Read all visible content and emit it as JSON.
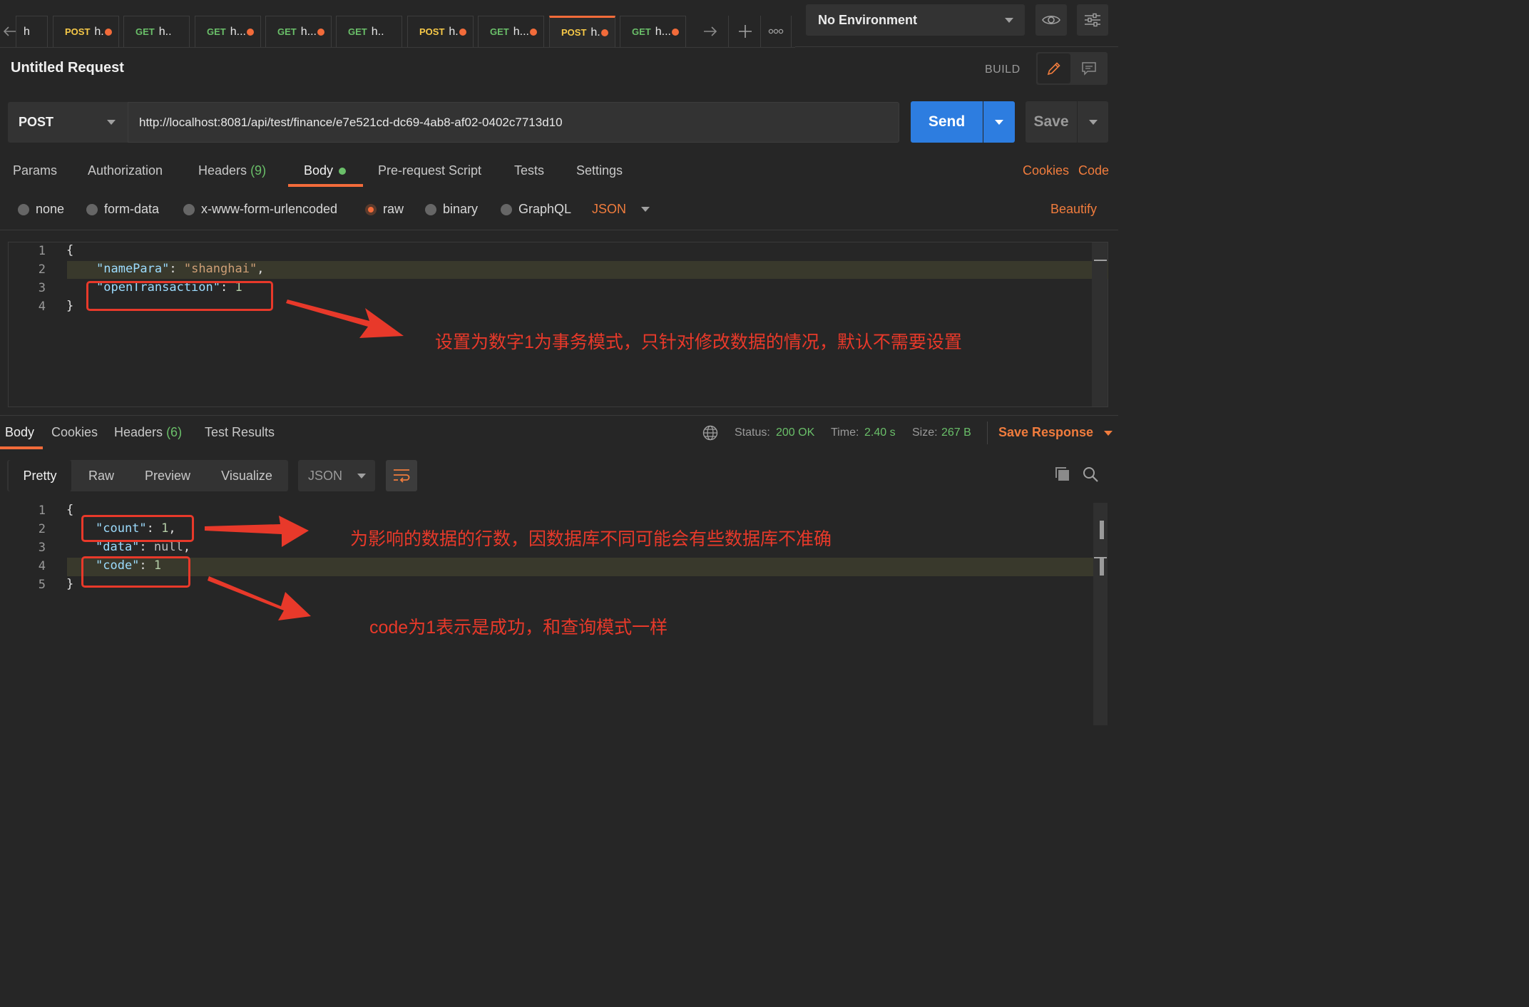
{
  "tabs": {
    "items": [
      {
        "method": "",
        "name": "h"
      },
      {
        "method": "POST",
        "name": "h.",
        "dot": true
      },
      {
        "method": "GET",
        "name": "h..",
        "dot": false
      },
      {
        "method": "GET",
        "name": "h...",
        "dot": true
      },
      {
        "method": "GET",
        "name": "h...",
        "dot": true
      },
      {
        "method": "GET",
        "name": "h..",
        "dot": false
      },
      {
        "method": "POST",
        "name": "h.",
        "dot": true
      },
      {
        "method": "GET",
        "name": "h...",
        "dot": true
      },
      {
        "method": "POST",
        "name": "h.",
        "dot": true,
        "active": true
      },
      {
        "method": "GET",
        "name": "h...",
        "dot": true
      }
    ]
  },
  "environment": {
    "selected": "No Environment"
  },
  "request": {
    "title": "Untitled Request",
    "mode_label": "BUILD",
    "method": "POST",
    "url": "http://localhost:8081/api/test/finance/e7e521cd-dc69-4ab8-af02-0402c7713d10",
    "send_label": "Send",
    "save_label": "Save",
    "tabs": {
      "params": "Params",
      "authorization": "Authorization",
      "headers": "Headers",
      "headers_count": "(9)",
      "body": "Body",
      "prerequest": "Pre-request Script",
      "tests": "Tests",
      "settings": "Settings"
    },
    "links": {
      "cookies": "Cookies",
      "code": "Code",
      "beautify": "Beautify"
    },
    "body_types": {
      "none": "none",
      "form_data": "form-data",
      "urlencoded": "x-www-form-urlencoded",
      "raw": "raw",
      "binary": "binary",
      "graphql": "GraphQL",
      "raw_format": "JSON"
    },
    "editor": {
      "line_numbers": [
        "1",
        "2",
        "3",
        "4"
      ],
      "open_brace": "{",
      "close_brace": "}",
      "key1": "\"namePara\"",
      "val1": "\"shanghai\"",
      "key2": "\"openTransaction\"",
      "val2": "1"
    },
    "annotation": "设置为数字1为事务模式，只针对修改数据的情况，默认不需要设置"
  },
  "response": {
    "tabs": {
      "body": "Body",
      "cookies": "Cookies",
      "headers": "Headers",
      "headers_count": "(6)",
      "test_results": "Test Results"
    },
    "status_label": "Status:",
    "status": "200 OK",
    "time_label": "Time:",
    "time": "2.40 s",
    "size_label": "Size:",
    "size": "267 B",
    "save_response": "Save Response",
    "views": {
      "pretty": "Pretty",
      "raw": "Raw",
      "preview": "Preview",
      "visualize": "Visualize"
    },
    "format": "JSON",
    "editor": {
      "line_numbers": [
        "1",
        "2",
        "3",
        "4",
        "5"
      ],
      "open_brace": "{",
      "close_brace": "}",
      "key_count": "\"count\"",
      "val_count": "1",
      "key_data": "\"data\"",
      "val_data": "null",
      "key_code": "\"code\"",
      "val_code": "1"
    },
    "annotation_count": "为影响的数据的行数，因数据库不同可能会有些数据库不准确",
    "annotation_code": "code为1表示是成功，和查询模式一样"
  },
  "colors": {
    "accent": "#f26b3a",
    "send": "#2d7de0",
    "annotation": "#e8392a",
    "success": "#6abf69"
  }
}
